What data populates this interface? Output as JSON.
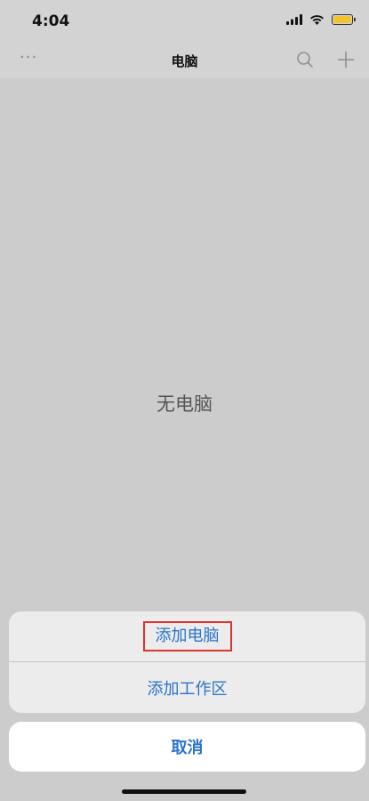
{
  "status_bar": {
    "time": "4:04",
    "battery_color": "#f3c230"
  },
  "nav": {
    "title": "电脑",
    "more_icon": "ellipsis-icon",
    "search_icon": "search-icon",
    "add_icon": "plus-icon"
  },
  "empty_state": {
    "label": "无电脑"
  },
  "action_sheet": {
    "items": [
      {
        "label": "添加电脑",
        "highlighted": true
      },
      {
        "label": "添加工作区"
      }
    ],
    "cancel_label": "取消",
    "accent_color": "#2a73cb",
    "highlight_color": "#e0332f"
  }
}
